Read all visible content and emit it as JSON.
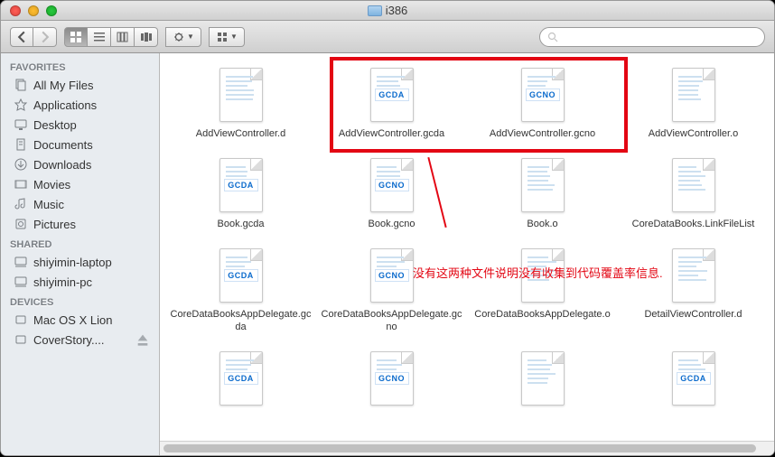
{
  "window": {
    "title": "i386"
  },
  "sidebar": {
    "sections": [
      {
        "header": "FAVORITES",
        "items": [
          {
            "icon": "all-files",
            "label": "All My Files"
          },
          {
            "icon": "apps",
            "label": "Applications"
          },
          {
            "icon": "desktop",
            "label": "Desktop"
          },
          {
            "icon": "documents",
            "label": "Documents"
          },
          {
            "icon": "downloads",
            "label": "Downloads"
          },
          {
            "icon": "movies",
            "label": "Movies"
          },
          {
            "icon": "music",
            "label": "Music"
          },
          {
            "icon": "pictures",
            "label": "Pictures"
          }
        ]
      },
      {
        "header": "SHARED",
        "items": [
          {
            "icon": "computer",
            "label": "shiyimin-laptop"
          },
          {
            "icon": "computer",
            "label": "shiyimin-pc"
          }
        ]
      },
      {
        "header": "DEVICES",
        "items": [
          {
            "icon": "disk",
            "label": "Mac OS X Lion"
          },
          {
            "icon": "disk",
            "label": "CoverStory....",
            "eject": true
          }
        ]
      }
    ]
  },
  "files": [
    {
      "name": "AddViewController.d",
      "badge": ""
    },
    {
      "name": "AddViewController.gcda",
      "badge": "GCDA"
    },
    {
      "name": "AddViewController.gcno",
      "badge": "GCNO"
    },
    {
      "name": "AddViewController.o",
      "badge": ""
    },
    {
      "name": "Book.gcda",
      "badge": "GCDA"
    },
    {
      "name": "Book.gcno",
      "badge": "GCNO"
    },
    {
      "name": "Book.o",
      "badge": ""
    },
    {
      "name": "CoreDataBooks.LinkFileList",
      "badge": ""
    },
    {
      "name": "CoreDataBooksAppDelegate.gcda",
      "badge": "GCDA"
    },
    {
      "name": "CoreDataBooksAppDelegate.gcno",
      "badge": "GCNO"
    },
    {
      "name": "CoreDataBooksAppDelegate.o",
      "badge": ""
    },
    {
      "name": "DetailViewController.d",
      "badge": ""
    },
    {
      "name": "",
      "badge": "GCDA"
    },
    {
      "name": "",
      "badge": "GCNO"
    },
    {
      "name": "",
      "badge": ""
    },
    {
      "name": "",
      "badge": "GCDA"
    }
  ],
  "annotation": {
    "text": "没有这两种文件说明没有收集到代码覆盖率信息."
  },
  "search": {
    "placeholder": ""
  }
}
